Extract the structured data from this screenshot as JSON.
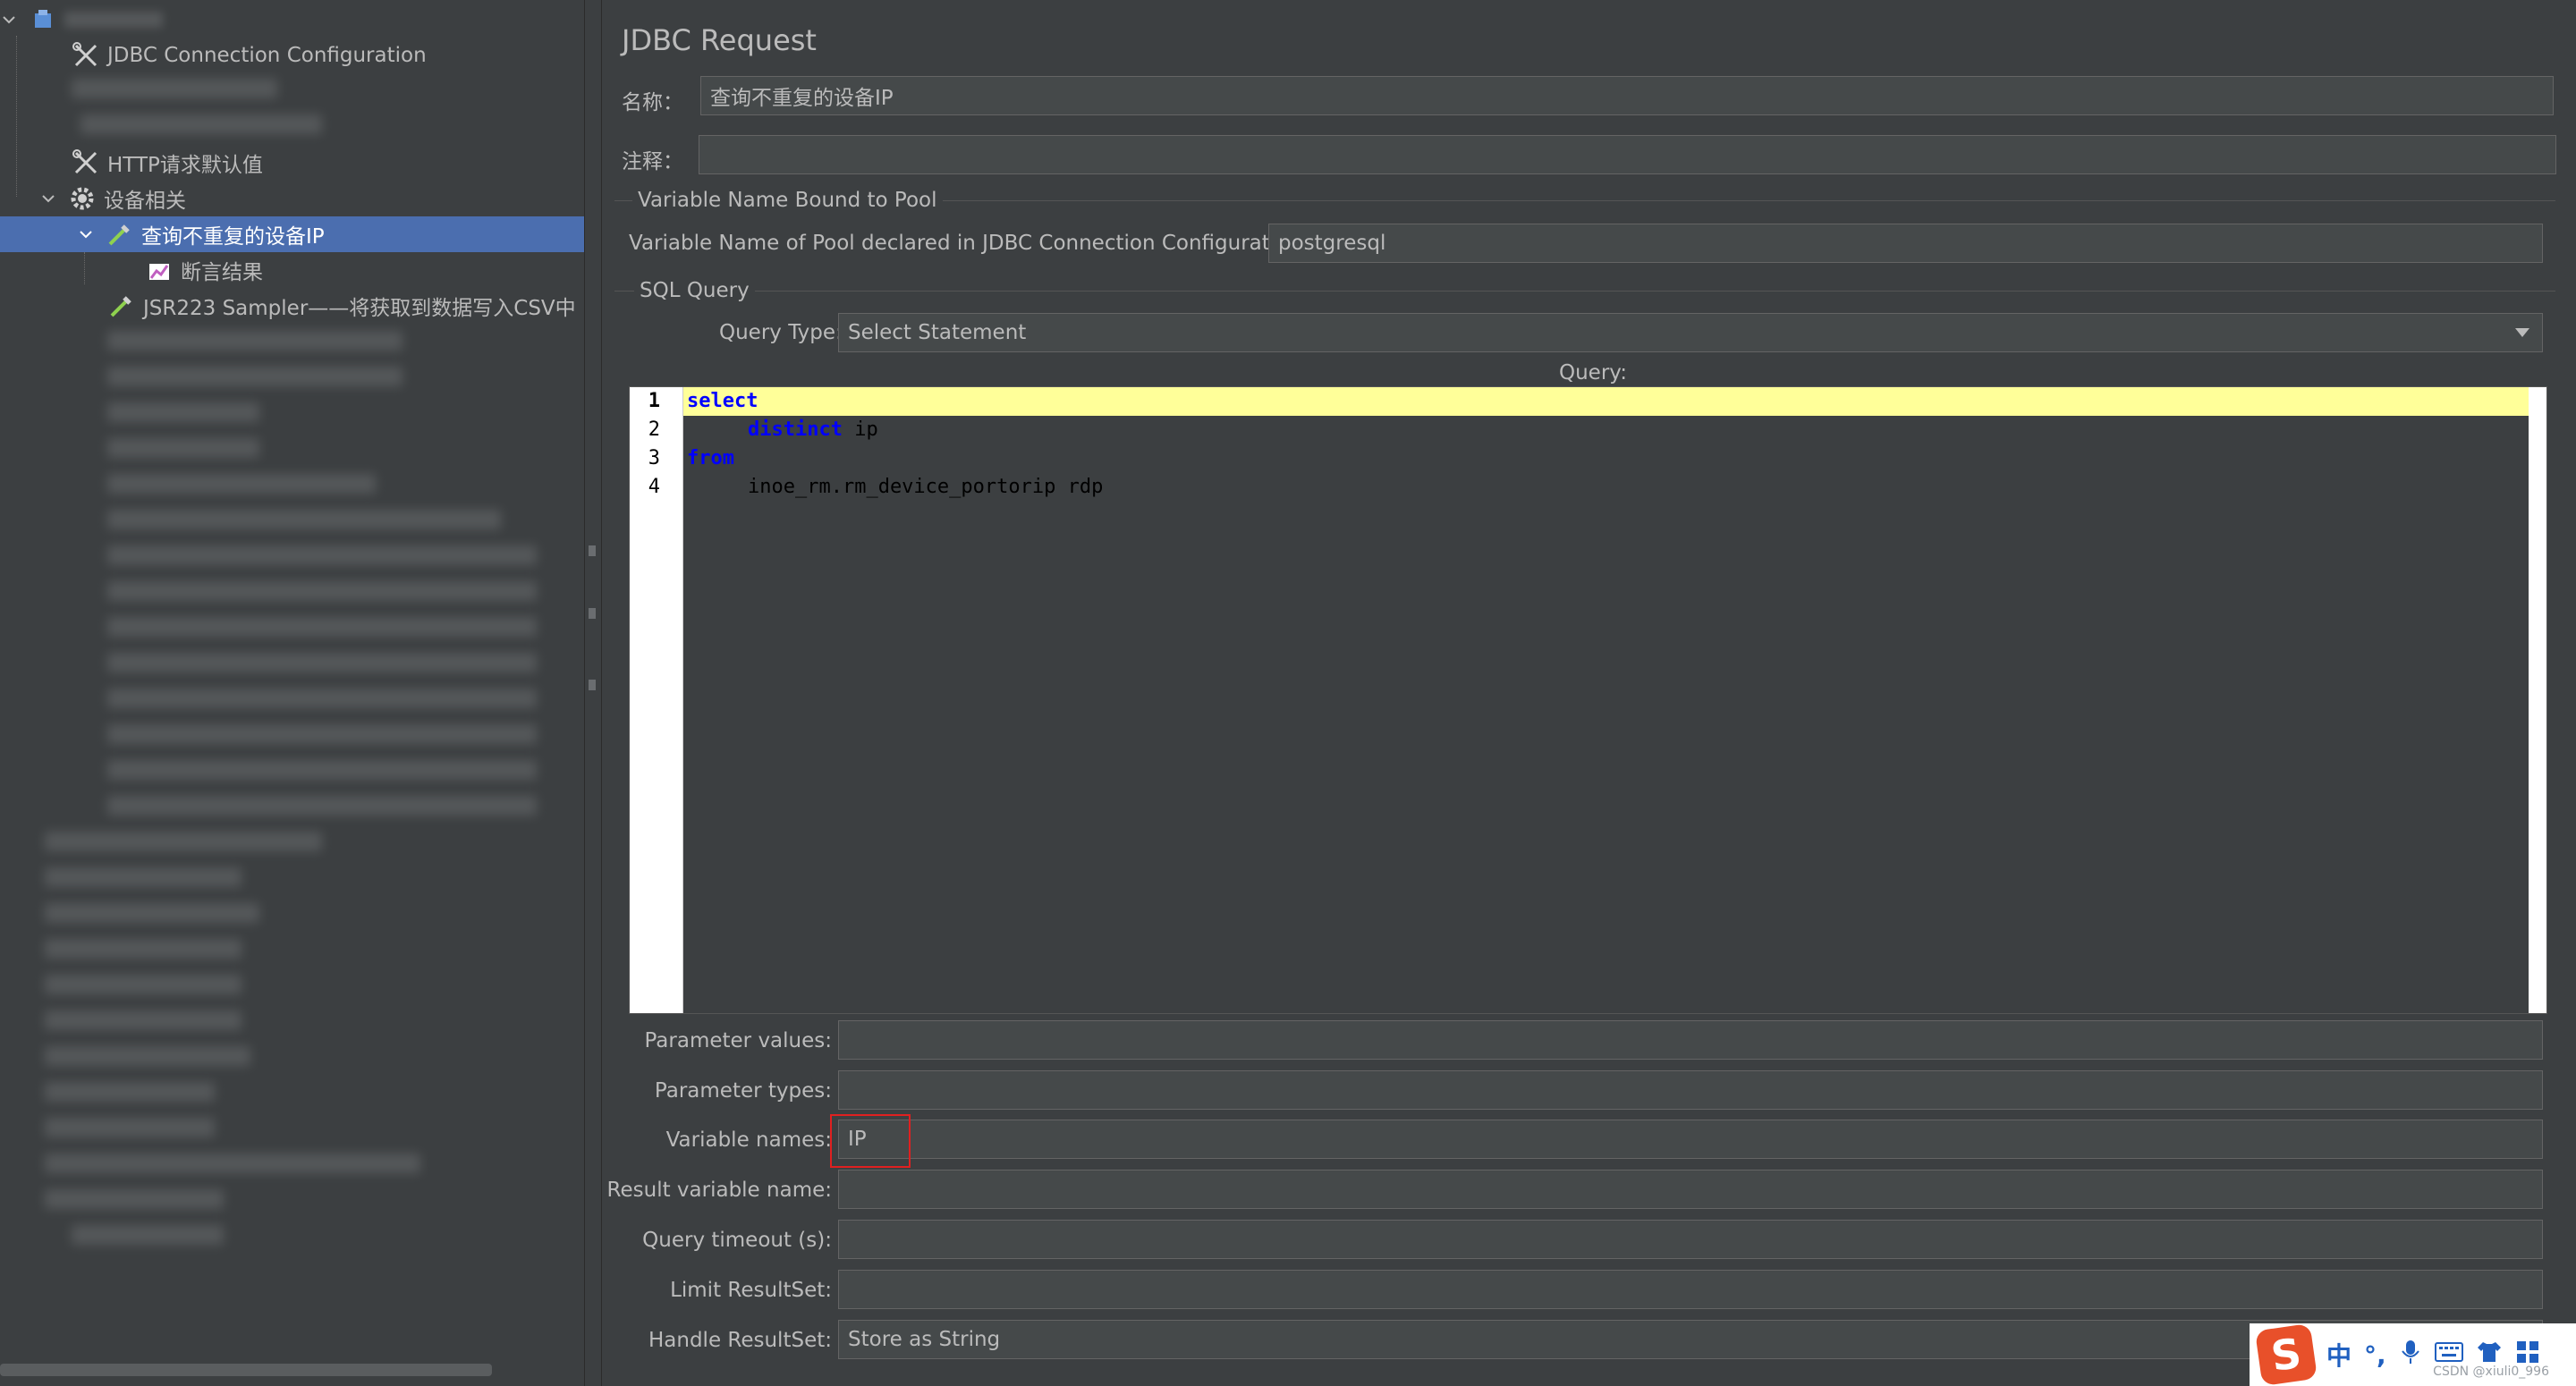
{
  "tree": {
    "items": [
      {
        "label": "JDBC Connection Configuration"
      },
      {
        "label": "HTTP请求默认值"
      },
      {
        "label": "设备相关"
      },
      {
        "label": "查询不重复的设备IP"
      },
      {
        "label": "断言结果"
      },
      {
        "label": "JSR223 Sampler——将获取到数据写入CSV中"
      }
    ]
  },
  "panel": {
    "title": "JDBC Request",
    "name_label": "名称：",
    "name_value": "查询不重复的设备IP",
    "comment_label": "注释：",
    "comment_value": "",
    "pool_group_title": "Variable Name Bound to Pool",
    "pool_label": "Variable Name of Pool declared in JDBC Connection Configuration:",
    "pool_value": "postgresql",
    "sql_group_title": "SQL Query",
    "query_type_label": "Query Type:",
    "query_type_value": "Select Statement",
    "query_label": "Query:",
    "code_lines": [
      {
        "num": "1",
        "keyword": "select",
        "text": ""
      },
      {
        "num": "2",
        "keyword": "distinct",
        "text": " ip"
      },
      {
        "num": "3",
        "keyword": "from",
        "text": ""
      },
      {
        "num": "4",
        "keyword": "",
        "text": "inoe_rm.rm_device_portorip rdp"
      }
    ],
    "param_values_label": "Parameter values:",
    "param_values_value": "",
    "param_types_label": "Parameter types:",
    "param_types_value": "",
    "var_names_label": "Variable names:",
    "var_names_value": "IP",
    "result_var_label": "Result variable name:",
    "result_var_value": "",
    "timeout_label": "Query timeout (s):",
    "timeout_value": "",
    "limit_label": "Limit ResultSet:",
    "limit_value": "",
    "handle_label": "Handle ResultSet:",
    "handle_value": "Store as String"
  },
  "ime": {
    "logo": "S",
    "lang": "中",
    "punct": "°,",
    "watermark": "CSDN @xiuli0_996"
  },
  "colors": {
    "background": "#3c3f41",
    "selection": "#4b6eaf",
    "field": "#45494a",
    "keyword": "#0000ff",
    "current_line": "#ffff99",
    "highlight_box": "#e02020"
  }
}
